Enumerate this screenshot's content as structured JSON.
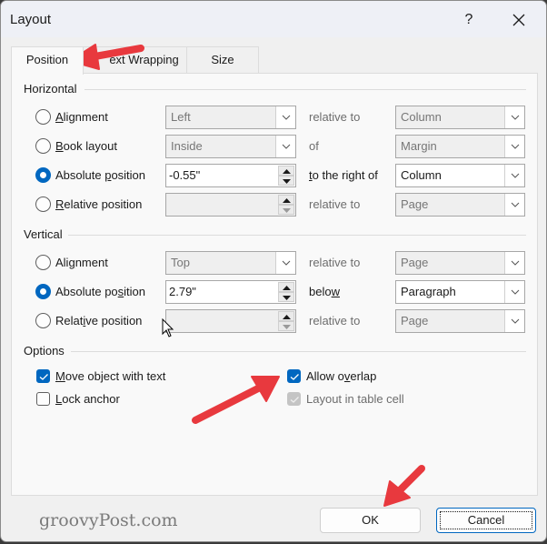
{
  "window": {
    "title": "Layout",
    "help_label": "?",
    "close_icon": "close-icon"
  },
  "tabs": [
    {
      "label": "Position",
      "active": true
    },
    {
      "label": "Text Wrapping",
      "visible_label": "ext Wrapping",
      "active": false
    },
    {
      "label": "Size",
      "active": false
    }
  ],
  "horizontal": {
    "group_label": "Horizontal",
    "rows": [
      {
        "option": "Alignment",
        "selected": false,
        "value": "Left",
        "value_enabled": false,
        "connector": "relative to",
        "target": "Column",
        "target_enabled": false
      },
      {
        "option": "Book layout",
        "selected": false,
        "value": "Inside",
        "value_enabled": false,
        "connector": "of",
        "target": "Margin",
        "target_enabled": false
      },
      {
        "option": "Absolute position",
        "selected": true,
        "value": "-0.55\"",
        "value_enabled": true,
        "connector": "to the right of",
        "target": "Column",
        "target_enabled": true
      },
      {
        "option": "Relative position",
        "selected": false,
        "value": "",
        "value_enabled": false,
        "connector": "relative to",
        "target": "Page",
        "target_enabled": false
      }
    ]
  },
  "vertical": {
    "group_label": "Vertical",
    "rows": [
      {
        "option": "Alignment",
        "selected": false,
        "value": "Top",
        "value_enabled": false,
        "connector": "relative to",
        "target": "Page",
        "target_enabled": false
      },
      {
        "option": "Absolute position",
        "selected": true,
        "value": "2.79\"",
        "value_enabled": true,
        "connector": "below",
        "target": "Paragraph",
        "target_enabled": true
      },
      {
        "option": "Relative position",
        "selected": false,
        "value": "",
        "value_enabled": false,
        "connector": "relative to",
        "target": "Page",
        "target_enabled": false
      }
    ]
  },
  "options": {
    "group_label": "Options",
    "checkboxes": [
      {
        "label": "Move object with text",
        "checked": true,
        "enabled": true
      },
      {
        "label": "Lock anchor",
        "checked": false,
        "enabled": true
      },
      {
        "label": "Allow overlap",
        "checked": true,
        "enabled": true
      },
      {
        "label": "Layout in table cell",
        "checked": true,
        "enabled": false
      }
    ]
  },
  "buttons": {
    "ok": "OK",
    "cancel": "Cancel"
  },
  "watermark": "groovyPost.com",
  "colors": {
    "accent": "#0067c0",
    "annotation_arrow": "#e8393e"
  }
}
